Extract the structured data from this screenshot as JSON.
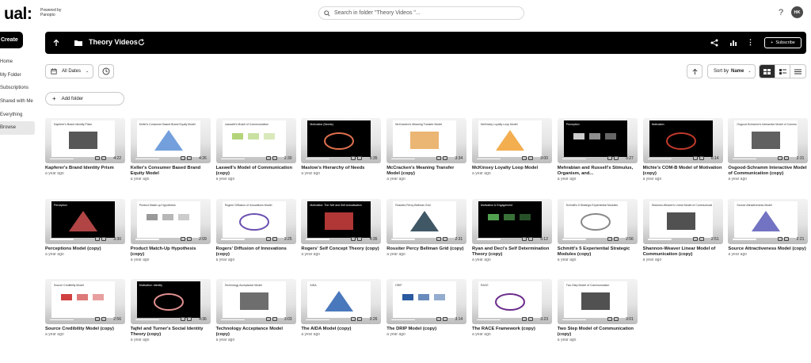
{
  "header": {
    "logo": "ual:",
    "powered_by": "Powered by\nPanopto",
    "search_placeholder": "Search in folder \"Theory Videos \"...",
    "help": "?",
    "avatar_initials": "HK"
  },
  "sidebar": {
    "create_label": "Create",
    "items": [
      {
        "label": "Home"
      },
      {
        "label": "My Folder"
      },
      {
        "label": "Subscriptions"
      },
      {
        "label": "Shared with Me"
      },
      {
        "label": "Everything"
      },
      {
        "label": "Browse"
      }
    ],
    "active_index": 5
  },
  "folder": {
    "title": "Theory Videos",
    "subscribe_label": "Subscribe"
  },
  "toolbar": {
    "date_filter": "All Dates",
    "sort_label": "Sort by",
    "sort_value": "Name",
    "add_folder": "Add folder",
    "active_view": "grid"
  },
  "videos": [
    {
      "title": "Kapferer's Brand Identity Prism",
      "date": "a year ago",
      "duration": "4:22",
      "slide_title": "Kapferer's Brand Identity Prism",
      "dark": false,
      "color": "#3a3a3a"
    },
    {
      "title": "Keller's Consumer Based Brand Equity Model",
      "date": "a year ago",
      "duration": "4:26",
      "slide_title": "Keller's Consumer Based Brand Equity Model",
      "dark": false,
      "color": "#5a8fd6"
    },
    {
      "title": "Laswell's Model of Communication (copy)",
      "date": "a year ago",
      "duration": "2:30",
      "slide_title": "Lasswell's Model of Communication",
      "dark": false,
      "color": "#b4d47a"
    },
    {
      "title": "Maslow's Hierarchy of Needs",
      "date": "a year ago",
      "duration": "5:35",
      "slide_title": "Motivation (Needs)",
      "dark": true,
      "color": "#e0704e"
    },
    {
      "title": "McCracken's Meaning Transfer Model (copy)",
      "date": "a year ago",
      "duration": "3:34",
      "slide_title": "McCracken's Meaning Transfer Model",
      "dark": false,
      "color": "#e8a85a"
    },
    {
      "title": "McKinsey Loyalty Loop Model",
      "date": "a year ago",
      "duration": "3:00",
      "slide_title": "McKinsey Loyalty Loop Model",
      "dark": false,
      "color": "#f0a030"
    },
    {
      "title": "Mehrabian and Russell's Stimulus, Organism, and...",
      "date": "a year ago",
      "duration": "5:27",
      "slide_title": "Perception",
      "dark": true,
      "color": "#cccccc"
    },
    {
      "title": "Michie's COM-B Model of Motivation (copy)",
      "date": "a year ago",
      "duration": "6:14",
      "slide_title": "Motivation",
      "dark": true,
      "color": "#c0392b"
    },
    {
      "title": "Osgood-Schramm Interactive Model of Communication (copy)",
      "date": "a year ago",
      "duration": "2:31",
      "slide_title": "Osgood-Schramm's Interactive Model of Communication",
      "dark": false,
      "color": "#444444"
    },
    {
      "title": "Perceptions Model (copy)",
      "date": "a year ago",
      "duration": "3:30",
      "slide_title": "Perception",
      "dark": true,
      "color": "#d05050"
    },
    {
      "title": "Product Match-Up Hypothesis (copy)",
      "date": "a year ago",
      "duration": "2:09",
      "slide_title": "Product Match-up Hypothesis",
      "dark": false,
      "color": "#999999"
    },
    {
      "title": "Rogers' Diffusion of Innovations (copy)",
      "date": "a year ago",
      "duration": "3:25",
      "slide_title": "Rogers' Diffusion of Innovations Model",
      "dark": false,
      "color": "#6a4fb0"
    },
    {
      "title": "Rogers' Self Concept Theory (copy)",
      "date": "a year ago",
      "duration": "4:35",
      "slide_title": "Motivation: The Self and Self Actualisation",
      "dark": true,
      "color": "#d04040"
    },
    {
      "title": "Rossiter Percy Bellman Grid (copy)",
      "date": "a year ago",
      "duration": "2:31",
      "slide_title": "Rossiter-Percy-Bellman Grid",
      "dark": false,
      "color": "#1f3a4a"
    },
    {
      "title": "Ryan and Deci's Self Determination Theory (copy)",
      "date": "a year ago",
      "duration": "5:12",
      "slide_title": "Motivation & Engagement",
      "dark": true,
      "color": "#50a050"
    },
    {
      "title": "Schmitt's 5 Experiential Strategic Modules (copy)",
      "date": "a year ago",
      "duration": "2:56",
      "slide_title": "Schmitt's 5 Strategic Experiential Modules",
      "dark": false,
      "color": "#888888"
    },
    {
      "title": "Shannon-Weaver Linear Model of Communication (copy)",
      "date": "a year ago",
      "duration": "2:51",
      "slide_title": "Shannon-Weaver's Linear Model of Communication",
      "dark": false,
      "color": "#333333"
    },
    {
      "title": "Source Attractiveness Model (copy)",
      "date": "a year ago",
      "duration": "2:21",
      "slide_title": "Source Attractiveness Model",
      "dark": false,
      "color": "#5a5ab8"
    },
    {
      "title": "Source Credibility Model (copy)",
      "date": "a year ago",
      "duration": "2:56",
      "slide_title": "Source Credibility Model",
      "dark": false,
      "color": "#d04040"
    },
    {
      "title": "Tajfel and Turner's Social Identity Theory (copy)",
      "date": "a year ago",
      "duration": "4:36",
      "slide_title": "Motivation: Identity",
      "dark": true,
      "color": "#e09090"
    },
    {
      "title": "Technology Acceptance Model (copy)",
      "date": "a year ago",
      "duration": "3:03",
      "slide_title": "Technology Acceptance Model",
      "dark": false,
      "color": "#555555"
    },
    {
      "title": "The AIDA Model (copy)",
      "date": "a year ago",
      "duration": "3:26",
      "slide_title": "AIDA",
      "dark": false,
      "color": "#2a60b0"
    },
    {
      "title": "The DRIP Model (copy)",
      "date": "a year ago",
      "duration": "3:14",
      "slide_title": "DRIP",
      "dark": false,
      "color": "#2a5aa0"
    },
    {
      "title": "The RACE Framework (copy)",
      "date": "a year ago",
      "duration": "3:23",
      "slide_title": "RACE",
      "dark": false,
      "color": "#6a2a8a"
    },
    {
      "title": "Two Step Model of Communication (copy)",
      "date": "a year ago",
      "duration": "3:01",
      "slide_title": "Two-Step Model of Communication",
      "dark": false,
      "color": "#333333"
    }
  ]
}
